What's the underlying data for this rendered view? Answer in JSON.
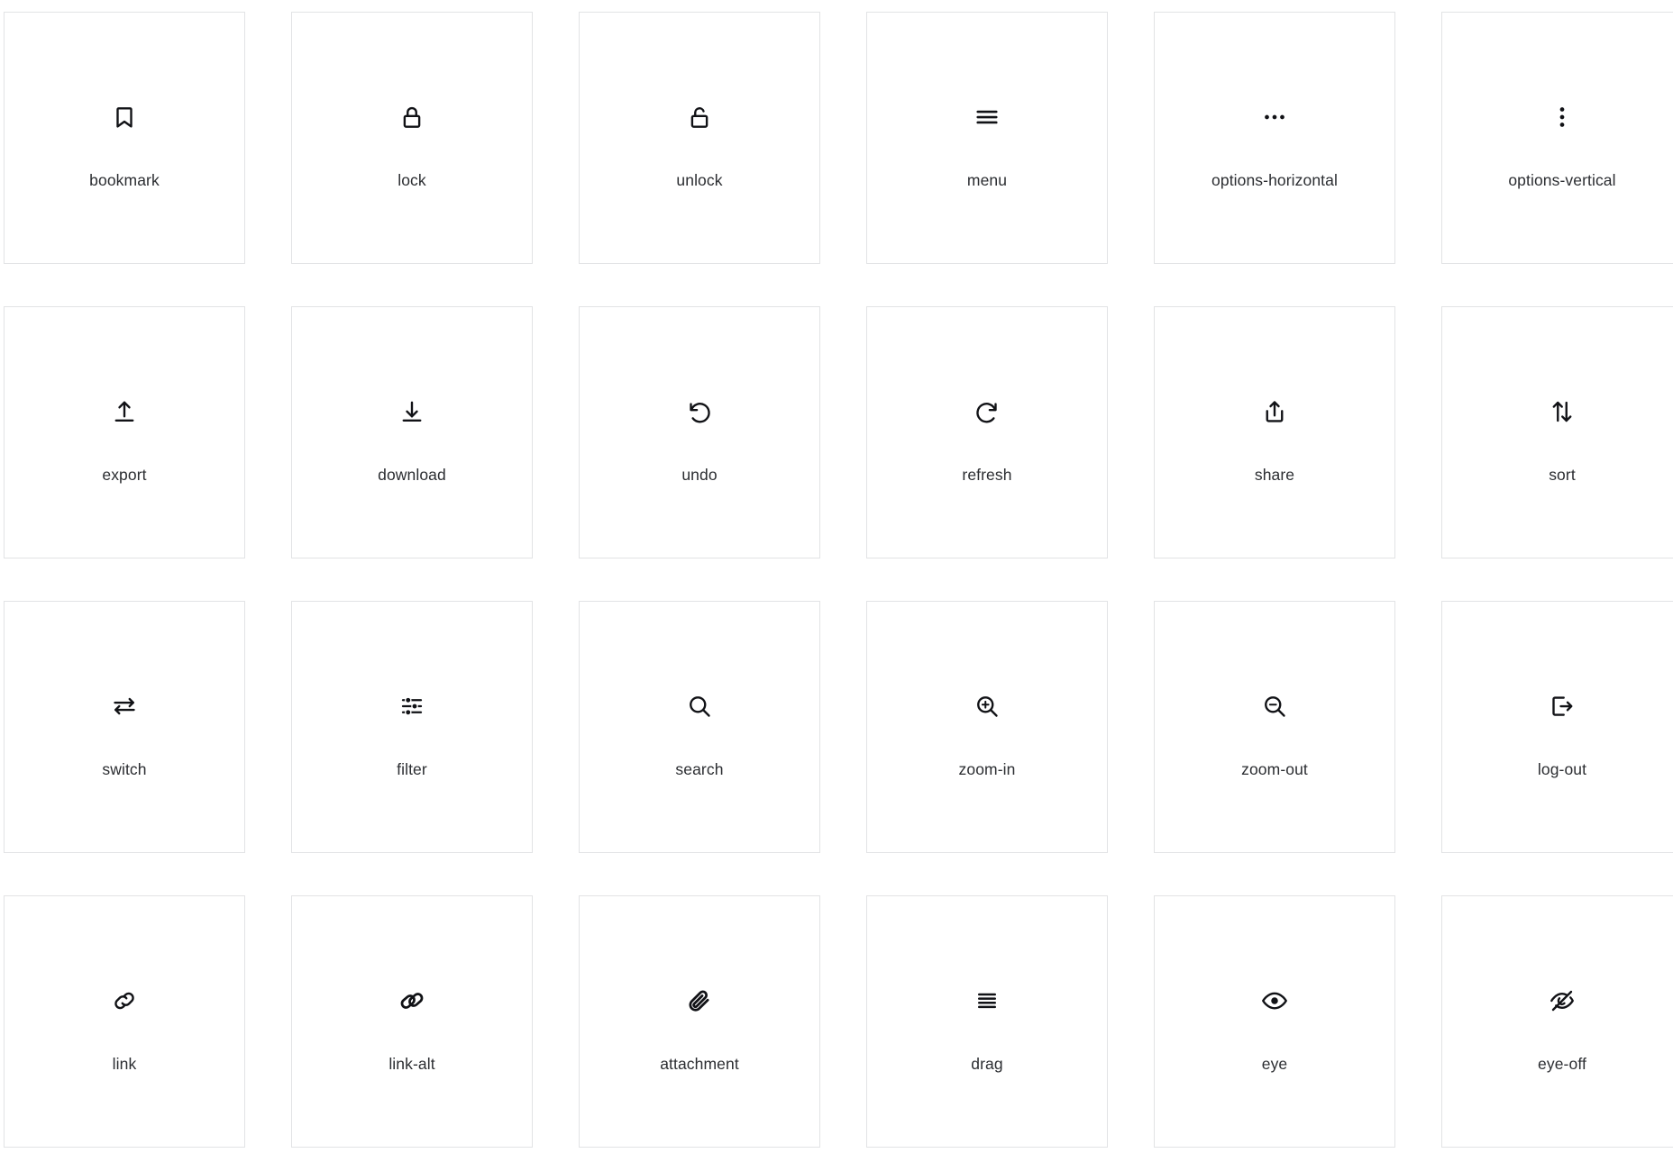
{
  "gallery": {
    "columns": 6,
    "rows": 4,
    "border_color": "#e2e3e5",
    "icon_color": "#111216",
    "label_color": "#2b2d31",
    "background": "#ffffff",
    "items": [
      {
        "name": "bookmark",
        "label": "bookmark",
        "icon": "bookmark-icon"
      },
      {
        "name": "lock",
        "label": "lock",
        "icon": "lock-icon"
      },
      {
        "name": "unlock",
        "label": "unlock",
        "icon": "unlock-icon"
      },
      {
        "name": "menu",
        "label": "menu",
        "icon": "menu-icon"
      },
      {
        "name": "options-horizontal",
        "label": "options-horizontal",
        "icon": "options-horizontal-icon"
      },
      {
        "name": "options-vertical",
        "label": "options-vertical",
        "icon": "options-vertical-icon"
      },
      {
        "name": "export",
        "label": "export",
        "icon": "export-icon"
      },
      {
        "name": "download",
        "label": "download",
        "icon": "download-icon"
      },
      {
        "name": "undo",
        "label": "undo",
        "icon": "undo-icon"
      },
      {
        "name": "refresh",
        "label": "refresh",
        "icon": "refresh-icon"
      },
      {
        "name": "share",
        "label": "share",
        "icon": "share-icon"
      },
      {
        "name": "sort",
        "label": "sort",
        "icon": "sort-icon"
      },
      {
        "name": "switch",
        "label": "switch",
        "icon": "switch-icon"
      },
      {
        "name": "filter",
        "label": "filter",
        "icon": "filter-icon"
      },
      {
        "name": "search",
        "label": "search",
        "icon": "search-icon"
      },
      {
        "name": "zoom-in",
        "label": "zoom-in",
        "icon": "zoom-in-icon"
      },
      {
        "name": "zoom-out",
        "label": "zoom-out",
        "icon": "zoom-out-icon"
      },
      {
        "name": "log-out",
        "label": "log-out",
        "icon": "log-out-icon"
      },
      {
        "name": "link",
        "label": "link",
        "icon": "link-icon"
      },
      {
        "name": "link-alt",
        "label": "link-alt",
        "icon": "link-alt-icon"
      },
      {
        "name": "attachment",
        "label": "attachment",
        "icon": "attachment-icon"
      },
      {
        "name": "drag",
        "label": "drag",
        "icon": "drag-icon"
      },
      {
        "name": "eye",
        "label": "eye",
        "icon": "eye-icon"
      },
      {
        "name": "eye-off",
        "label": "eye-off",
        "icon": "eye-off-icon"
      }
    ]
  }
}
